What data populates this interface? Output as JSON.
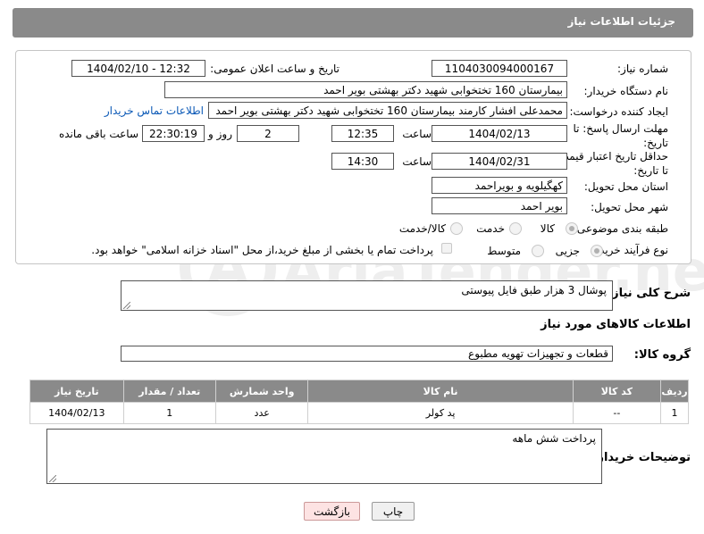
{
  "header": {
    "title": "جزئیات اطلاعات نیاز"
  },
  "form": {
    "need_number": {
      "label": "شماره نیاز:",
      "value": "1104030094000167"
    },
    "announce_datetime": {
      "label": "تاریخ و ساعت اعلان عمومی:",
      "value": "1404/02/10 - 12:32"
    },
    "buyer_org": {
      "label": "نام دستگاه خریدار:",
      "value": "بیمارستان 160 تختخوابی شهید دکتر بهشتی بویر احمد"
    },
    "requester": {
      "label": "ایجاد کننده درخواست:",
      "value": "محمدعلی افشار کارمند بیمارستان 160 تختخوابی شهید دکتر بهشتی بویر احمد",
      "link": "اطلاعات تماس خریدار"
    },
    "reply_deadline": {
      "label": "مهلت ارسال پاسخ: تا تاریخ:",
      "date": "1404/02/13",
      "time_label": "ساعت",
      "time": "12:35",
      "days": "2",
      "days_label": "روز و",
      "remaining": "22:30:19",
      "remaining_label": "ساعت باقی مانده"
    },
    "price_validity": {
      "label": "حداقل تاریخ اعتبار قیمت: تا تاریخ:",
      "date": "1404/02/31",
      "time_label": "ساعت",
      "time": "14:30"
    },
    "delivery_province": {
      "label": "استان محل تحویل:",
      "value": "کهگیلویه و بویراحمد"
    },
    "delivery_city": {
      "label": "شهر محل تحویل:",
      "value": "بویر احمد"
    },
    "category": {
      "label": "طبقه بندی موضوعی:",
      "options": [
        "کالا",
        "خدمت",
        "کالا/خدمت"
      ],
      "selected": "کالا"
    },
    "purchase_type": {
      "label": "نوع فرآیند خرید :",
      "options": [
        "جزیی",
        "متوسط"
      ],
      "selected": "جزیی",
      "payment_note": "پرداخت تمام یا بخشی از مبلغ خرید،از محل \"اسناد خزانه اسلامی\" خواهد بود."
    }
  },
  "description": {
    "label": "شرح کلی نیاز:",
    "value": "پوشال 3 هزار طبق فایل پیوستی"
  },
  "goods_info": {
    "title": "اطلاعات کالاهای مورد نیاز"
  },
  "goods_group": {
    "label": "گروه کالا:",
    "value": "قطعات و تجهیزات تهویه مطبوع"
  },
  "table": {
    "headers": [
      "ردیف",
      "کد کالا",
      "نام کالا",
      "واحد شمارش",
      "تعداد / مقدار",
      "تاریخ نیاز"
    ],
    "rows": [
      {
        "row": "1",
        "code": "--",
        "name": "پد کولر",
        "unit": "عدد",
        "qty": "1",
        "date": "1404/02/13"
      }
    ]
  },
  "buyer_notes": {
    "label": "توضیحات خریدار:",
    "value": "پرداخت شش ماهه"
  },
  "buttons": {
    "print": "چاپ",
    "back": "بازگشت"
  },
  "watermark": {
    "text": "AriaTender.net"
  }
}
